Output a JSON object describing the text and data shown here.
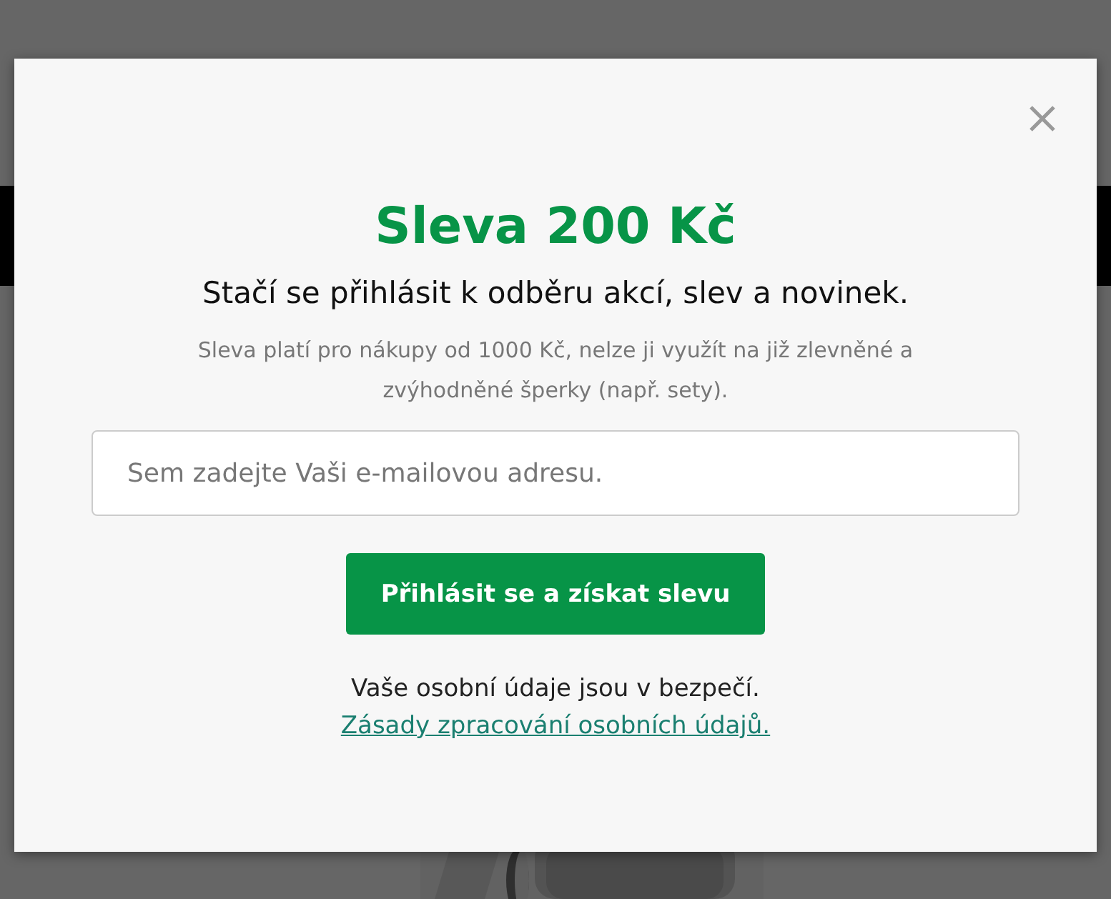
{
  "popup": {
    "title": "Sleva 200 Kč",
    "subtitle": "Stačí se přihlásit k odběru akcí, slev a novinek.",
    "note": "Sleva platí pro nákupy od 1000 Kč, nelze ji využít na již zlevněné a zvýhodněné šperky (např. sety).",
    "email_field": {
      "placeholder": "Sem zadejte Vaši e-mailovou adresu."
    },
    "submit_button": "Přihlásit se a získat slevu",
    "privacy_note": "Vaše osobní údaje jsou v bezpečí.",
    "privacy_link": "Zásady zpracování osobních údajů."
  }
}
